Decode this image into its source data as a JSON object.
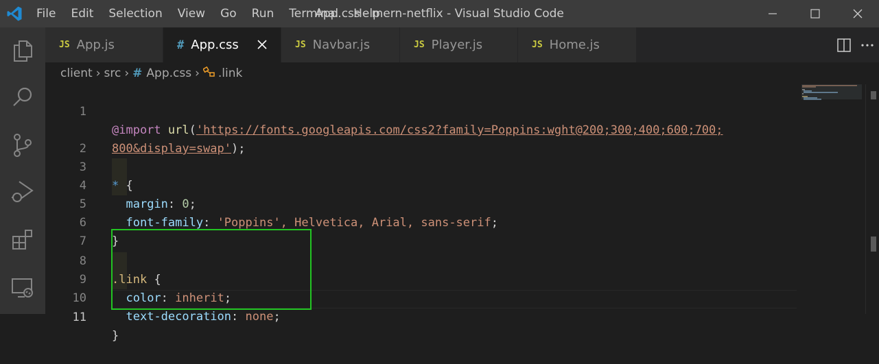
{
  "window": {
    "title": "App.css - mern-netflix - Visual Studio Code",
    "menu": [
      "File",
      "Edit",
      "Selection",
      "View",
      "Go",
      "Run",
      "Terminal",
      "Help"
    ]
  },
  "tabs": [
    {
      "label": "App.js",
      "icon": "JS",
      "type": "js",
      "active": false
    },
    {
      "label": "App.css",
      "icon": "#",
      "type": "css",
      "active": true
    },
    {
      "label": "Navbar.js",
      "icon": "JS",
      "type": "js",
      "active": false
    },
    {
      "label": "Player.js",
      "icon": "JS",
      "type": "js",
      "active": false
    },
    {
      "label": "Home.js",
      "icon": "JS",
      "type": "js",
      "active": false
    }
  ],
  "breadcrumb": {
    "items": [
      "client",
      "src",
      "App.css",
      ".link"
    ]
  },
  "editor": {
    "lines": [
      {
        "n": "1",
        "text1": "@import",
        "text2": "url",
        "text3": "https://fonts.googleapis.com/css2?family=Poppins:wght@200;300;400;600;700;"
      },
      {
        "n": "",
        "text1": "800&display=swap"
      },
      {
        "n": "2"
      },
      {
        "n": "3",
        "text1": "*",
        "text2": "{"
      },
      {
        "n": "4",
        "text1": "margin",
        "text2": "0"
      },
      {
        "n": "5",
        "text1": "font-family",
        "text2": "'Poppins', Helvetica, Arial, sans-serif"
      },
      {
        "n": "6",
        "text1": "}"
      },
      {
        "n": "7"
      },
      {
        "n": "8",
        "text1": ".link",
        "text2": "{"
      },
      {
        "n": "9",
        "text1": "color",
        "text2": "inherit"
      },
      {
        "n": "10",
        "text1": "text-decoration",
        "text2": "none"
      },
      {
        "n": "11",
        "text1": "}"
      }
    ]
  },
  "colors": {
    "highlight_box": "#22c522",
    "editor_bg": "#1e1e1e",
    "accent": "#007acc"
  },
  "icons": [
    "vscode-logo-icon",
    "explorer-icon",
    "search-icon",
    "source-control-icon",
    "run-debug-icon",
    "extensions-icon",
    "remote-explorer-icon",
    "split-editor-icon",
    "more-actions-icon",
    "close-icon",
    "minimize-icon",
    "maximize-icon"
  ]
}
